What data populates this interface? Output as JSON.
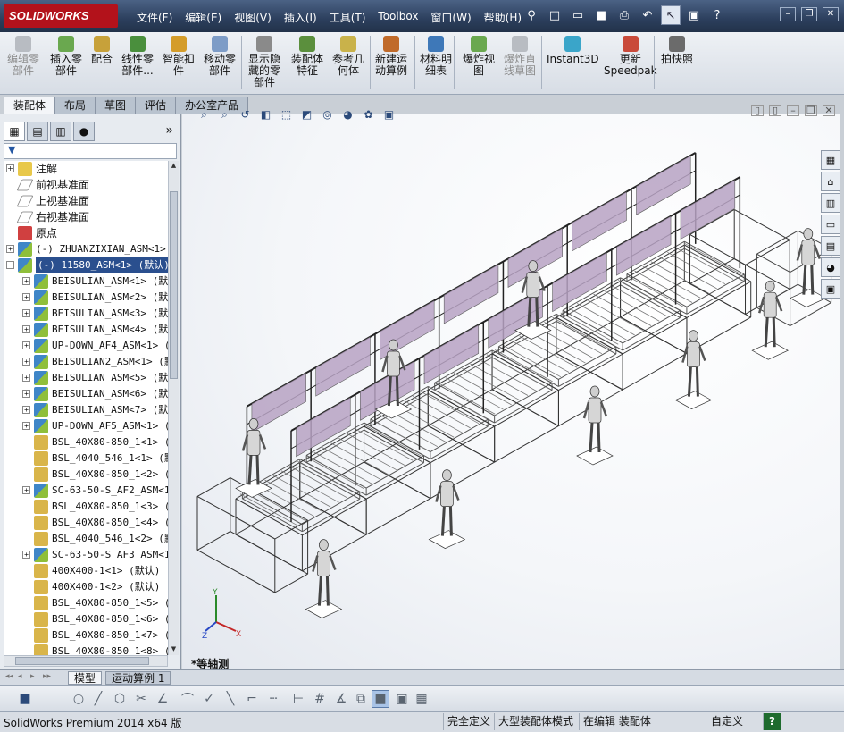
{
  "app": {
    "logo": "SOLIDWORKS"
  },
  "menu": [
    "文件(F)",
    "编辑(E)",
    "视图(V)",
    "插入(I)",
    "工具(T)",
    "Toolbox",
    "窗口(W)",
    "帮助(H)"
  ],
  "quick_icons": [
    "pin-icon",
    "new-document-icon",
    "open-icon",
    "save-icon",
    "print-icon",
    "undo-icon",
    "select-pointer-icon",
    "rebuild-icon",
    "help-icon"
  ],
  "window_controls": [
    "minimize-icon",
    "restore-icon",
    "close-icon"
  ],
  "command_manager": [
    {
      "label": "编辑零\n部件",
      "icon": "edit-component-icon",
      "enabled": false
    },
    {
      "label": "插入零\n部件",
      "icon": "insert-component-icon",
      "enabled": true
    },
    {
      "label": "配合",
      "icon": "mate-icon",
      "enabled": true
    },
    {
      "label": "线性零\n部件...",
      "icon": "linear-pattern-icon",
      "enabled": true
    },
    {
      "label": "智能扣\n件",
      "icon": "smart-fastener-icon",
      "enabled": true
    },
    {
      "label": "移动零\n部件",
      "icon": "move-component-icon",
      "enabled": true
    },
    {
      "label": "显示隐\n藏的零\n部件",
      "icon": "show-hidden-icon",
      "enabled": true
    },
    {
      "label": "装配体\n特征",
      "icon": "assembly-feature-icon",
      "enabled": true
    },
    {
      "label": "参考几\n何体",
      "icon": "reference-geometry-icon",
      "enabled": true
    },
    {
      "label": "新建运\n动算例",
      "icon": "motion-study-icon",
      "enabled": true
    },
    {
      "label": "材料明\n细表",
      "icon": "bom-icon",
      "enabled": true
    },
    {
      "label": "爆炸视\n图",
      "icon": "exploded-view-icon",
      "enabled": true
    },
    {
      "label": "爆炸直\n线草图",
      "icon": "explode-line-icon",
      "enabled": false
    },
    {
      "label": "Instant3D",
      "icon": "instant3d-icon",
      "enabled": true
    },
    {
      "label": "更新\nSpeedpak",
      "icon": "speedpak-icon",
      "enabled": true
    },
    {
      "label": "拍快照",
      "icon": "snapshot-icon",
      "enabled": true
    }
  ],
  "tabs": [
    {
      "label": "装配体",
      "active": true
    },
    {
      "label": "布局",
      "active": false
    },
    {
      "label": "草图",
      "active": false
    },
    {
      "label": "评估",
      "active": false
    },
    {
      "label": "办公室产品",
      "active": false
    }
  ],
  "panel": {
    "tab_icons": [
      "feature-manager-icon",
      "property-manager-icon",
      "configuration-manager-icon",
      "display-manager-icon"
    ],
    "expand_label": "»",
    "filter_icon": "filter-icon",
    "filter_placeholder": "",
    "tree": [
      {
        "text": "注解",
        "icon": "annotation-icon",
        "expand": true,
        "level": 0,
        "cn": true
      },
      {
        "text": "前视基准面",
        "icon": "plane-icon",
        "expand": false,
        "level": 0,
        "cn": true
      },
      {
        "text": "上视基准面",
        "icon": "plane-icon",
        "expand": false,
        "level": 0,
        "cn": true
      },
      {
        "text": "右视基准面",
        "icon": "plane-icon",
        "expand": false,
        "level": 0,
        "cn": true
      },
      {
        "text": "原点",
        "icon": "origin-icon",
        "expand": false,
        "level": 0,
        "cn": true
      },
      {
        "text": "(-) ZHUANZIXIAN_ASM<1> (",
        "icon": "subassembly-icon",
        "expand": true,
        "level": 0
      },
      {
        "text": "(-) 11580_ASM<1> (默认)",
        "icon": "subassembly-icon",
        "expand": true,
        "level": 0,
        "selected": true,
        "open": true
      },
      {
        "text": "BEISULIAN_ASM<1> (默认",
        "icon": "subassembly-icon",
        "expand": true,
        "level": 1
      },
      {
        "text": "BEISULIAN_ASM<2> (默认",
        "icon": "subassembly-icon",
        "expand": true,
        "level": 1
      },
      {
        "text": "BEISULIAN_ASM<3> (默认",
        "icon": "subassembly-icon",
        "expand": true,
        "level": 1
      },
      {
        "text": "BEISULIAN_ASM<4> (默认",
        "icon": "subassembly-icon",
        "expand": true,
        "level": 1
      },
      {
        "text": "UP-DOWN_AF4_ASM<1> (默",
        "icon": "subassembly-icon",
        "expand": true,
        "level": 1
      },
      {
        "text": "BEISULIAN2_ASM<1> (默",
        "icon": "subassembly-icon",
        "expand": true,
        "level": 1
      },
      {
        "text": "BEISULIAN_ASM<5> (默认",
        "icon": "subassembly-icon",
        "expand": true,
        "level": 1
      },
      {
        "text": "BEISULIAN_ASM<6> (默认",
        "icon": "subassembly-icon",
        "expand": true,
        "level": 1
      },
      {
        "text": "BEISULIAN_ASM<7> (默认",
        "icon": "subassembly-icon",
        "expand": true,
        "level": 1
      },
      {
        "text": "UP-DOWN_AF5_ASM<1> (默",
        "icon": "subassembly-icon",
        "expand": true,
        "level": 1
      },
      {
        "text": "BSL_40X80-850_1<1> (",
        "icon": "part-icon",
        "expand": false,
        "level": 1
      },
      {
        "text": "BSL_4040_546_1<1> (默",
        "icon": "part-icon",
        "expand": false,
        "level": 1
      },
      {
        "text": "BSL_40X80-850_1<2> (",
        "icon": "part-icon",
        "expand": false,
        "level": 1
      },
      {
        "text": "SC-63-50-S_AF2_ASM<1>",
        "icon": "subassembly-icon",
        "expand": true,
        "level": 1
      },
      {
        "text": "BSL_40X80-850_1<3> (",
        "icon": "part-icon",
        "expand": false,
        "level": 1
      },
      {
        "text": "BSL_40X80-850_1<4> (",
        "icon": "part-icon",
        "expand": false,
        "level": 1
      },
      {
        "text": "BSL_4040_546_1<2> (默",
        "icon": "part-icon",
        "expand": false,
        "level": 1
      },
      {
        "text": "SC-63-50-S_AF3_ASM<1>",
        "icon": "subassembly-icon",
        "expand": true,
        "level": 1
      },
      {
        "text": "400X400-1<1> (默认)",
        "icon": "part-icon",
        "expand": false,
        "level": 1
      },
      {
        "text": "400X400-1<2> (默认)",
        "icon": "part-icon",
        "expand": false,
        "level": 1
      },
      {
        "text": "BSL_40X80-850_1<5> (",
        "icon": "part-icon",
        "expand": false,
        "level": 1
      },
      {
        "text": "BSL_40X80-850_1<6> (",
        "icon": "part-icon",
        "expand": false,
        "level": 1
      },
      {
        "text": "BSL_40X80-850_1<7> (",
        "icon": "part-icon",
        "expand": false,
        "level": 1
      },
      {
        "text": "BSL_40X80-850_1<8> (",
        "icon": "part-icon",
        "expand": false,
        "level": 1
      }
    ]
  },
  "viewport": {
    "heads_up_icons": [
      "zoom-to-fit-icon",
      "zoom-to-area-icon",
      "previous-view-icon",
      "section-view-icon",
      "view-orientation-icon",
      "display-style-icon",
      "hide-show-items-icon",
      "edit-appearance-icon",
      "apply-scene-icon",
      "view-settings-icon"
    ],
    "view_controls": [
      "tile-icon",
      "tile-icon",
      "minimize-icon",
      "restore-icon",
      "close-icon"
    ],
    "task_pane_icons": [
      "resources-icon",
      "home-icon",
      "design-library-icon",
      "file-explorer-icon",
      "view-palette-icon",
      "appearances-icon",
      "custom-properties-icon"
    ],
    "view_name": "*等轴测",
    "axis_labels": {
      "x": "X",
      "y": "Y",
      "z": "Z"
    }
  },
  "bottom_tabs": [
    {
      "label": "模型",
      "active": true
    },
    {
      "label": "运动算例 1",
      "active": false
    }
  ],
  "bottom_toolbar_icons": [
    "save-icon",
    "circle-icon",
    "line-icon",
    "polygon-icon",
    "trim-icon",
    "angle-icon",
    "fillet-icon",
    "check-icon",
    "slash-icon",
    "corner-icon",
    "dashed-line-icon",
    "dimension-icon",
    "grid-icon",
    "angle-dimension-icon",
    "3d-box-icon",
    "shaded-box-icon",
    "display-icon",
    "table-icon"
  ],
  "status": {
    "product": "SolidWorks Premium 2014 x64 版",
    "fully_defined": "完全定义",
    "large_assembly": "大型装配体模式",
    "editing": "在编辑 装配体",
    "custom": "自定义",
    "help_icon": "help-icon"
  },
  "colors": {
    "title_bar": "#2c3f5d",
    "selection": "#2a4f8e",
    "logo": "#b3121b",
    "frame_purple": "#b8a3c4"
  }
}
